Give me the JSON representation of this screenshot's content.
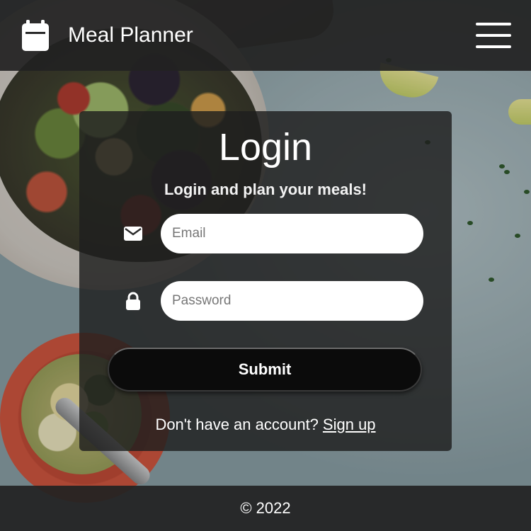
{
  "header": {
    "title": "Meal Planner",
    "logo_icon": "calendar-icon",
    "menu_icon": "hamburger-menu-icon"
  },
  "login": {
    "title": "Login",
    "subtitle": "Login and plan your meals!",
    "email": {
      "icon": "envelope-icon",
      "placeholder": "Email",
      "value": ""
    },
    "password": {
      "icon": "lock-icon",
      "placeholder": "Password",
      "value": ""
    },
    "submit_label": "Submit",
    "signup_prompt": "Don't have an account?",
    "signup_link": "Sign up"
  },
  "footer": {
    "copyright": "© 2022"
  },
  "colors": {
    "header_bg": "#222222",
    "card_bg": "#1e1e1e",
    "button_bg": "#0b0b0b",
    "text": "#ffffff"
  }
}
